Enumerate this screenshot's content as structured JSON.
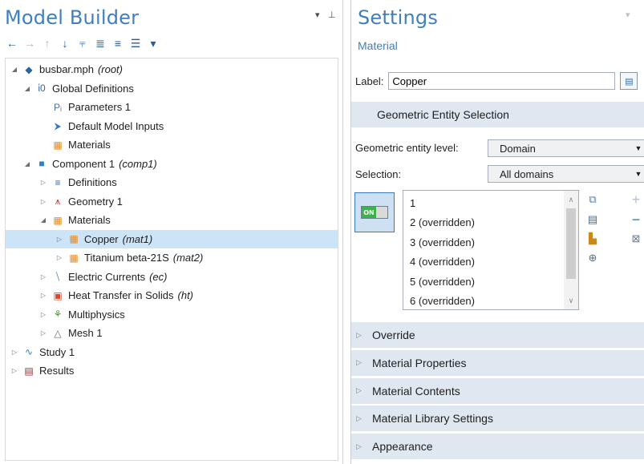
{
  "model_builder": {
    "title": "Model Builder",
    "toolbar": [
      {
        "icon": "arrow-left-icon",
        "glyph": "←",
        "enabled": true
      },
      {
        "icon": "arrow-right-icon",
        "glyph": "→",
        "enabled": false
      },
      {
        "icon": "arrow-up-icon",
        "glyph": "↑",
        "enabled": false
      },
      {
        "icon": "arrow-down-icon",
        "glyph": "↓",
        "enabled": true
      },
      {
        "icon": "filter-icon",
        "glyph": "⫧",
        "enabled": true
      },
      {
        "icon": "expand-tree-icon",
        "glyph": "≣",
        "enabled": true
      },
      {
        "icon": "collapse-tree-icon",
        "glyph": "≡",
        "enabled": true
      },
      {
        "icon": "view-options-icon",
        "glyph": "☰",
        "enabled": true
      },
      {
        "icon": "dropdown-icon",
        "glyph": "▾",
        "enabled": true
      }
    ],
    "tree": [
      {
        "label": "busbar.mph",
        "tag": "(root)",
        "twisty": "◢",
        "icon": "model-root-icon",
        "glyph": "◆",
        "color": "#2c63a5"
      },
      {
        "label": "Global Definitions",
        "tag": "",
        "twisty": "◢",
        "icon": "globe-icon",
        "glyph": "ἱ0",
        "color": "#2c63a5"
      },
      {
        "label": "Parameters 1",
        "tag": "",
        "twisty": "",
        "icon": "parameters-icon",
        "glyph": "Pᵢ",
        "color": "#4a6da0"
      },
      {
        "label": "Default Model Inputs",
        "tag": "",
        "twisty": "",
        "icon": "model-inputs-icon",
        "glyph": "⮞",
        "color": "#3777c4"
      },
      {
        "label": "Materials",
        "tag": "",
        "twisty": "",
        "icon": "materials-icon",
        "glyph": "▦",
        "color": "#e8891c"
      },
      {
        "label": "Component 1",
        "tag": "(comp1)",
        "twisty": "◢",
        "icon": "component-icon",
        "glyph": "■",
        "color": "#2c7fc9"
      },
      {
        "label": "Definitions",
        "tag": "",
        "twisty": "▷",
        "icon": "definitions-icon",
        "glyph": "≡",
        "color": "#2c63a5"
      },
      {
        "label": "Geometry 1",
        "tag": "",
        "twisty": "▷",
        "icon": "geometry-icon",
        "glyph": "⩚",
        "color": "#d23b3b"
      },
      {
        "label": "Materials",
        "tag": "",
        "twisty": "◢",
        "icon": "materials-icon",
        "glyph": "▦",
        "color": "#e8891c"
      },
      {
        "label": "Copper",
        "tag": "(mat1)",
        "twisty": "▷",
        "icon": "material-icon",
        "glyph": "▦",
        "color": "#e8891c",
        "selected": true
      },
      {
        "label": "Titanium beta-21S",
        "tag": "(mat2)",
        "twisty": "▷",
        "icon": "material-icon",
        "glyph": "▦",
        "color": "#e8891c"
      },
      {
        "label": "Electric Currents",
        "tag": "(ec)",
        "twisty": "▷",
        "icon": "electric-currents-icon",
        "glyph": "⧹",
        "color": "#2c63a5"
      },
      {
        "label": "Heat Transfer in Solids",
        "tag": "(ht)",
        "twisty": "▷",
        "icon": "heat-transfer-icon",
        "glyph": "▣",
        "color": "#d9482b"
      },
      {
        "label": "Multiphysics",
        "tag": "",
        "twisty": "▷",
        "icon": "multiphysics-icon",
        "glyph": "⚘",
        "color": "#4b8a3c"
      },
      {
        "label": "Mesh 1",
        "tag": "",
        "twisty": "▷",
        "icon": "mesh-icon",
        "glyph": "△",
        "color": "#5b6a79"
      },
      {
        "label": "Study 1",
        "tag": "",
        "twisty": "▷",
        "icon": "study-icon",
        "glyph": "∿",
        "color": "#2c7fc9"
      },
      {
        "label": "Results",
        "tag": "",
        "twisty": "▷",
        "icon": "results-icon",
        "glyph": "▤",
        "color": "#8a2d2d"
      }
    ]
  },
  "settings": {
    "title": "Settings",
    "subtitle": "Material",
    "label_caption": "Label:",
    "label_value": "Copper",
    "geo_section": "Geometric Entity Selection",
    "entity_level_caption": "Geometric entity level:",
    "entity_level_value": "Domain",
    "selection_caption": "Selection:",
    "selection_value": "All domains",
    "toggle_on": "ON",
    "domains": [
      "1",
      "2 (overridden)",
      "3 (overridden)",
      "4 (overridden)",
      "5 (overridden)",
      "6 (overridden)"
    ],
    "sections": [
      "Override",
      "Material Properties",
      "Material Contents",
      "Material Library Settings",
      "Appearance"
    ]
  },
  "colors": {
    "title_blue": "#3f7fbf",
    "section_bg": "#dfe8f1",
    "selected_row": "#cce4f7",
    "toggle_green": "#3bb34a"
  }
}
